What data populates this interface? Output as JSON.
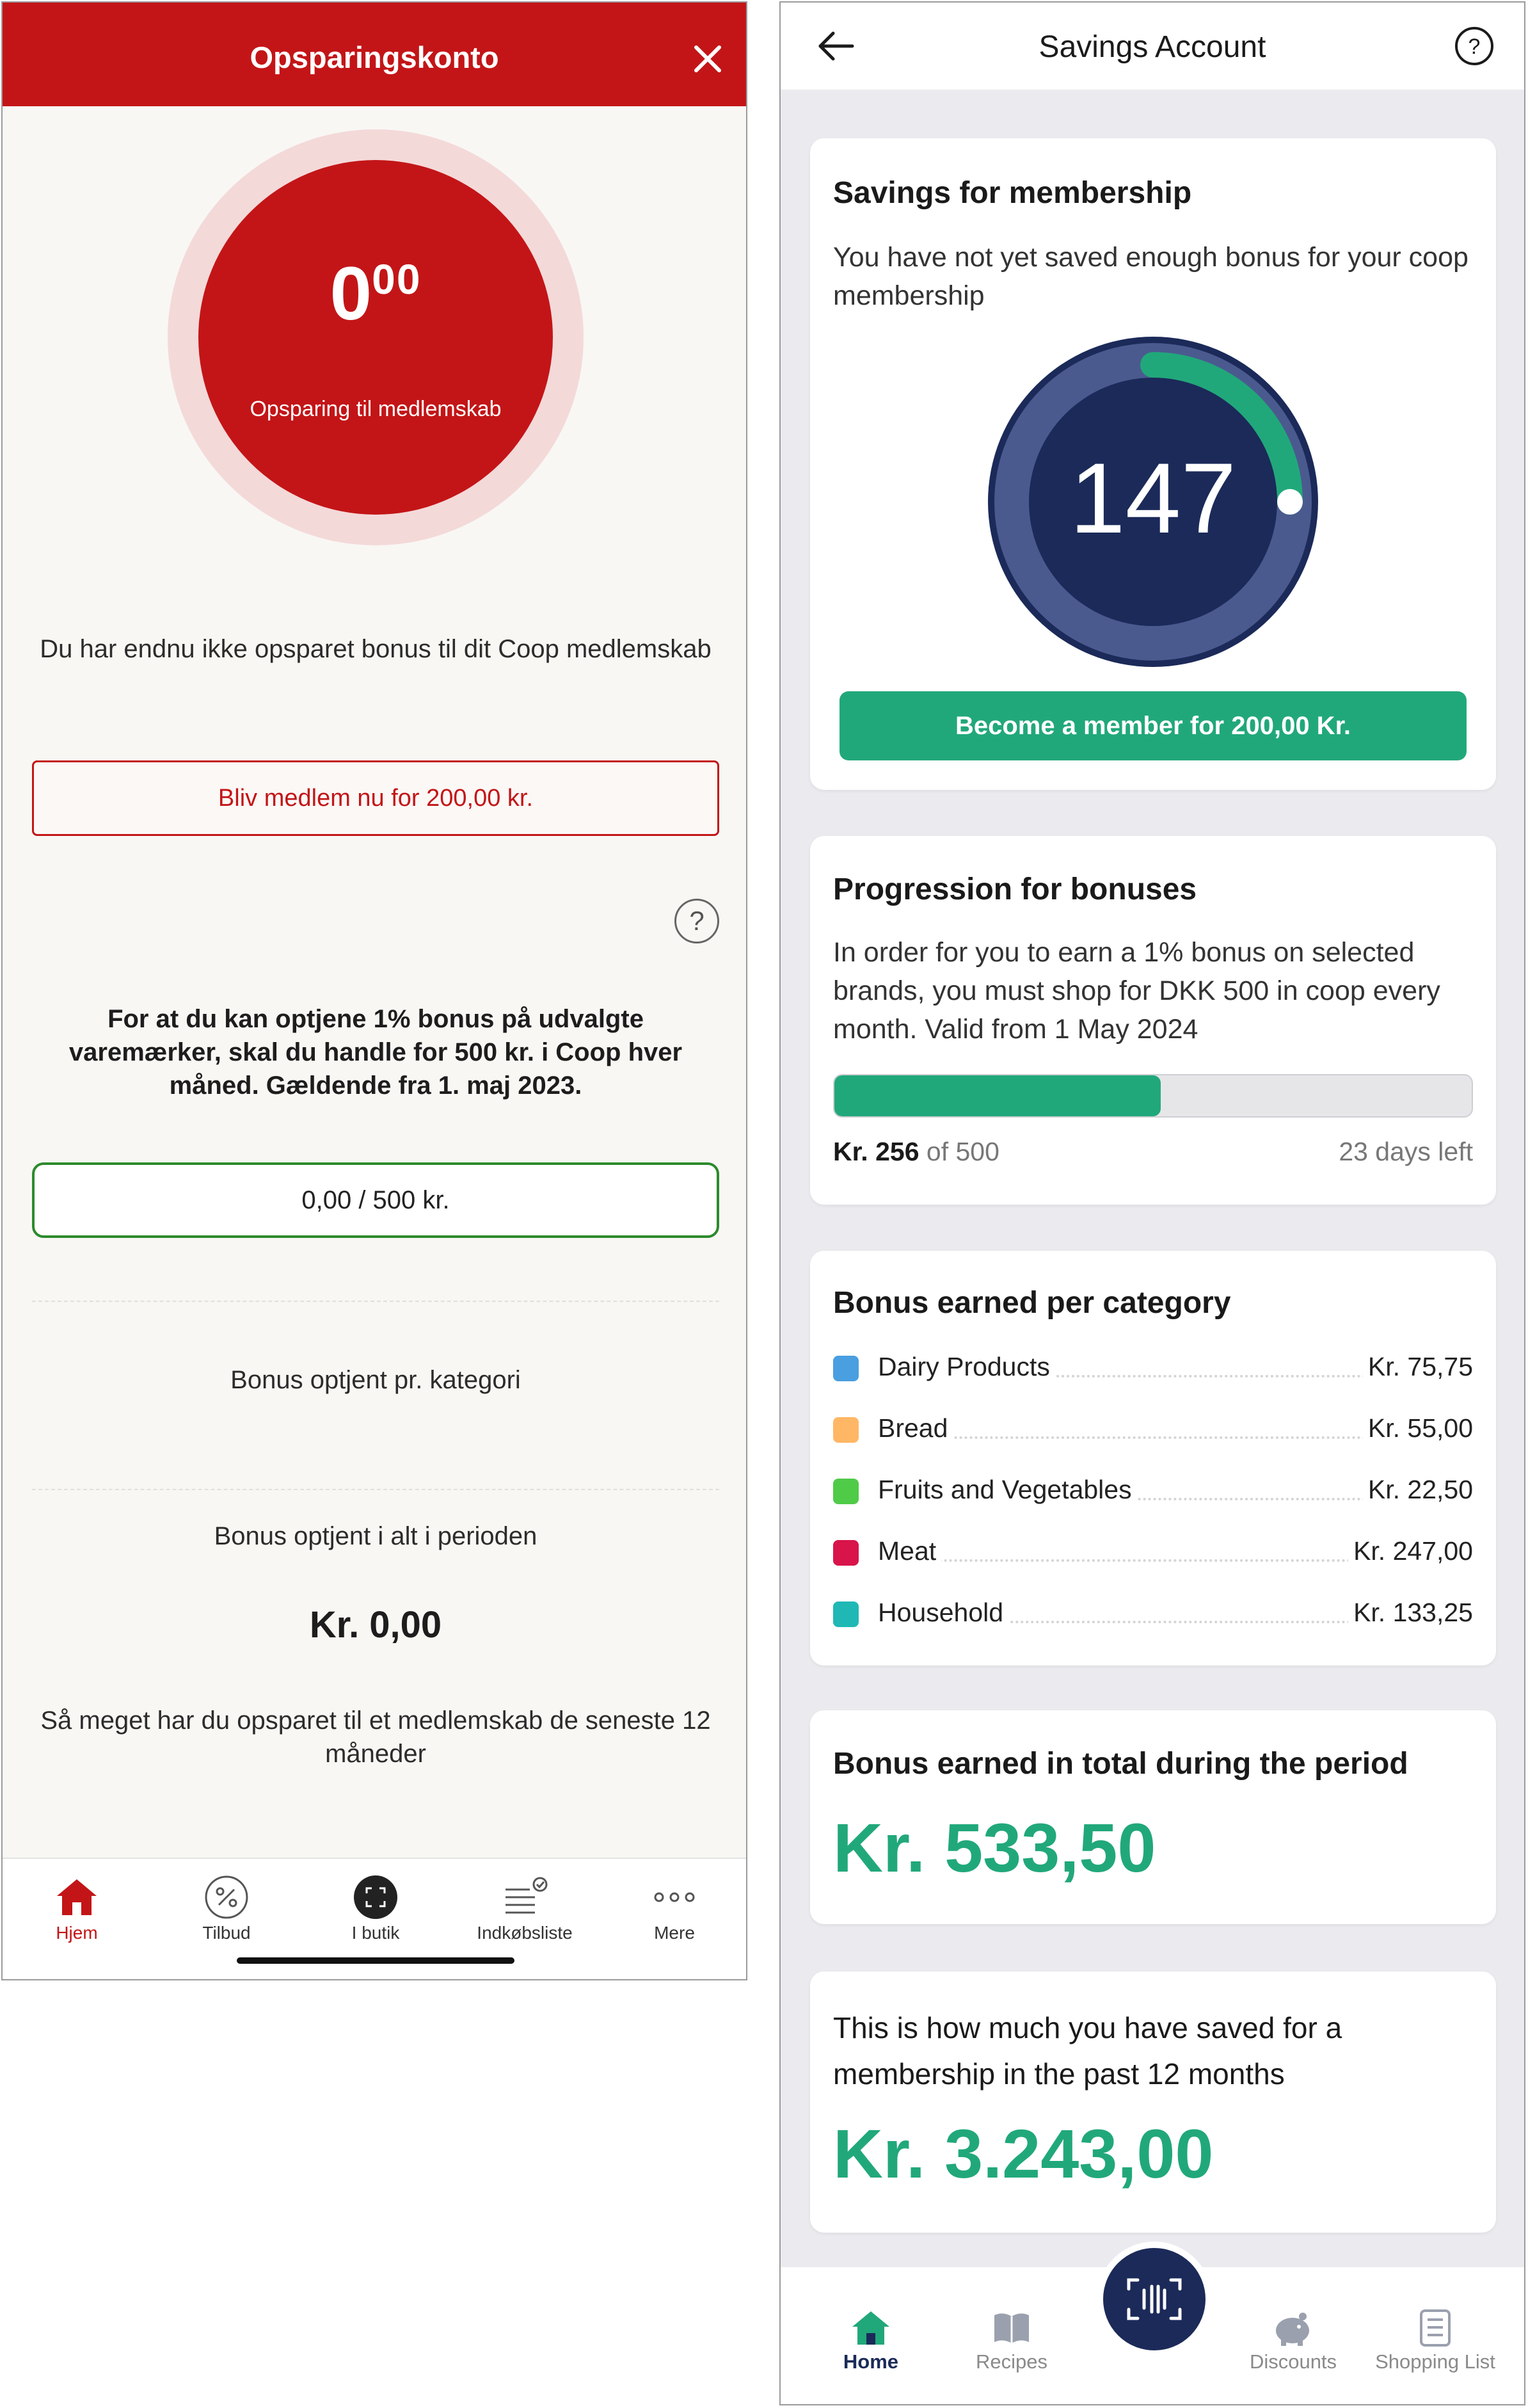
{
  "left": {
    "header": {
      "title": "Opsparingskonto"
    },
    "ring": {
      "amount_main": "0",
      "amount_cents": "00",
      "caption": "Opsparing til medlemskab"
    },
    "not_saved_text": "Du har endnu ikke opsparet bonus til dit Coop medlemskab",
    "become_member_button": "Bliv medlem nu for 200,00 kr.",
    "bonus_info": "For at du kan optjene 1% bonus på udvalgte varemærker, skal du handle for 500 kr. i Coop hver måned. Gældende fra 1. maj 2023.",
    "progress_text": "0,00 / 500 kr.",
    "category_heading": "Bonus optjent pr. kategori",
    "period_heading": "Bonus optjent i alt i perioden",
    "period_total": "Kr. 0,00",
    "saved_text": "Så meget har du opsparet til et medlemskab de seneste 12 måneder",
    "nav": [
      {
        "label": "Hjem",
        "icon": "home-icon",
        "active": true
      },
      {
        "label": "Tilbud",
        "icon": "percent-icon",
        "active": false
      },
      {
        "label": "I butik",
        "icon": "scan-icon",
        "active": false
      },
      {
        "label": "Indkøbsliste",
        "icon": "checklist-icon",
        "active": false
      },
      {
        "label": "Mere",
        "icon": "more-dots-icon",
        "active": false
      }
    ],
    "colors": {
      "brand_red": "#c31517",
      "green_border": "#2d8a2d"
    }
  },
  "right": {
    "header": {
      "title": "Savings Account"
    },
    "membership": {
      "title": "Savings for membership",
      "text": "You have not yet saved enough bonus for your coop membership",
      "gauge_value": "147",
      "gauge_fraction": 0.25,
      "button": "Become a member for 200,00 Kr."
    },
    "progression": {
      "title": "Progression for bonuses",
      "text": "In order for you to earn a 1% bonus on selected brands, you must shop for DKK 500 in coop every month. Valid from 1 May 2024",
      "current": "Kr. 256",
      "of_text": "of 500",
      "days_left": "23 days left",
      "fraction": 0.512
    },
    "categories": {
      "title": "Bonus earned per category",
      "items": [
        {
          "name": "Dairy Products",
          "value": "Kr. 75,75",
          "color": "#4a9fe0"
        },
        {
          "name": "Bread",
          "value": "Kr. 55,00",
          "color": "#ffb766"
        },
        {
          "name": "Fruits and Vegetables",
          "value": "Kr. 22,50",
          "color": "#4fcb48"
        },
        {
          "name": "Meat",
          "value": "Kr. 247,00",
          "color": "#d8144a"
        },
        {
          "name": "Household",
          "value": "Kr. 133,25",
          "color": "#1fb8b5"
        }
      ]
    },
    "period": {
      "title": "Bonus earned in total during the period",
      "total": "Kr. 533,50"
    },
    "saved": {
      "text": "This is how much you have saved for a membership in the past 12 months",
      "total": "Kr. 3.243,00"
    },
    "nav": [
      {
        "label": "Home",
        "icon": "home-icon",
        "active": true
      },
      {
        "label": "Recipes",
        "icon": "book-icon",
        "active": false
      },
      {
        "label": "Discounts",
        "icon": "piggy-bank-icon",
        "active": false
      },
      {
        "label": "Shopping List",
        "icon": "list-icon",
        "active": false
      }
    ],
    "colors": {
      "accent_green": "#21a87a",
      "navy": "#1b2a59"
    }
  }
}
